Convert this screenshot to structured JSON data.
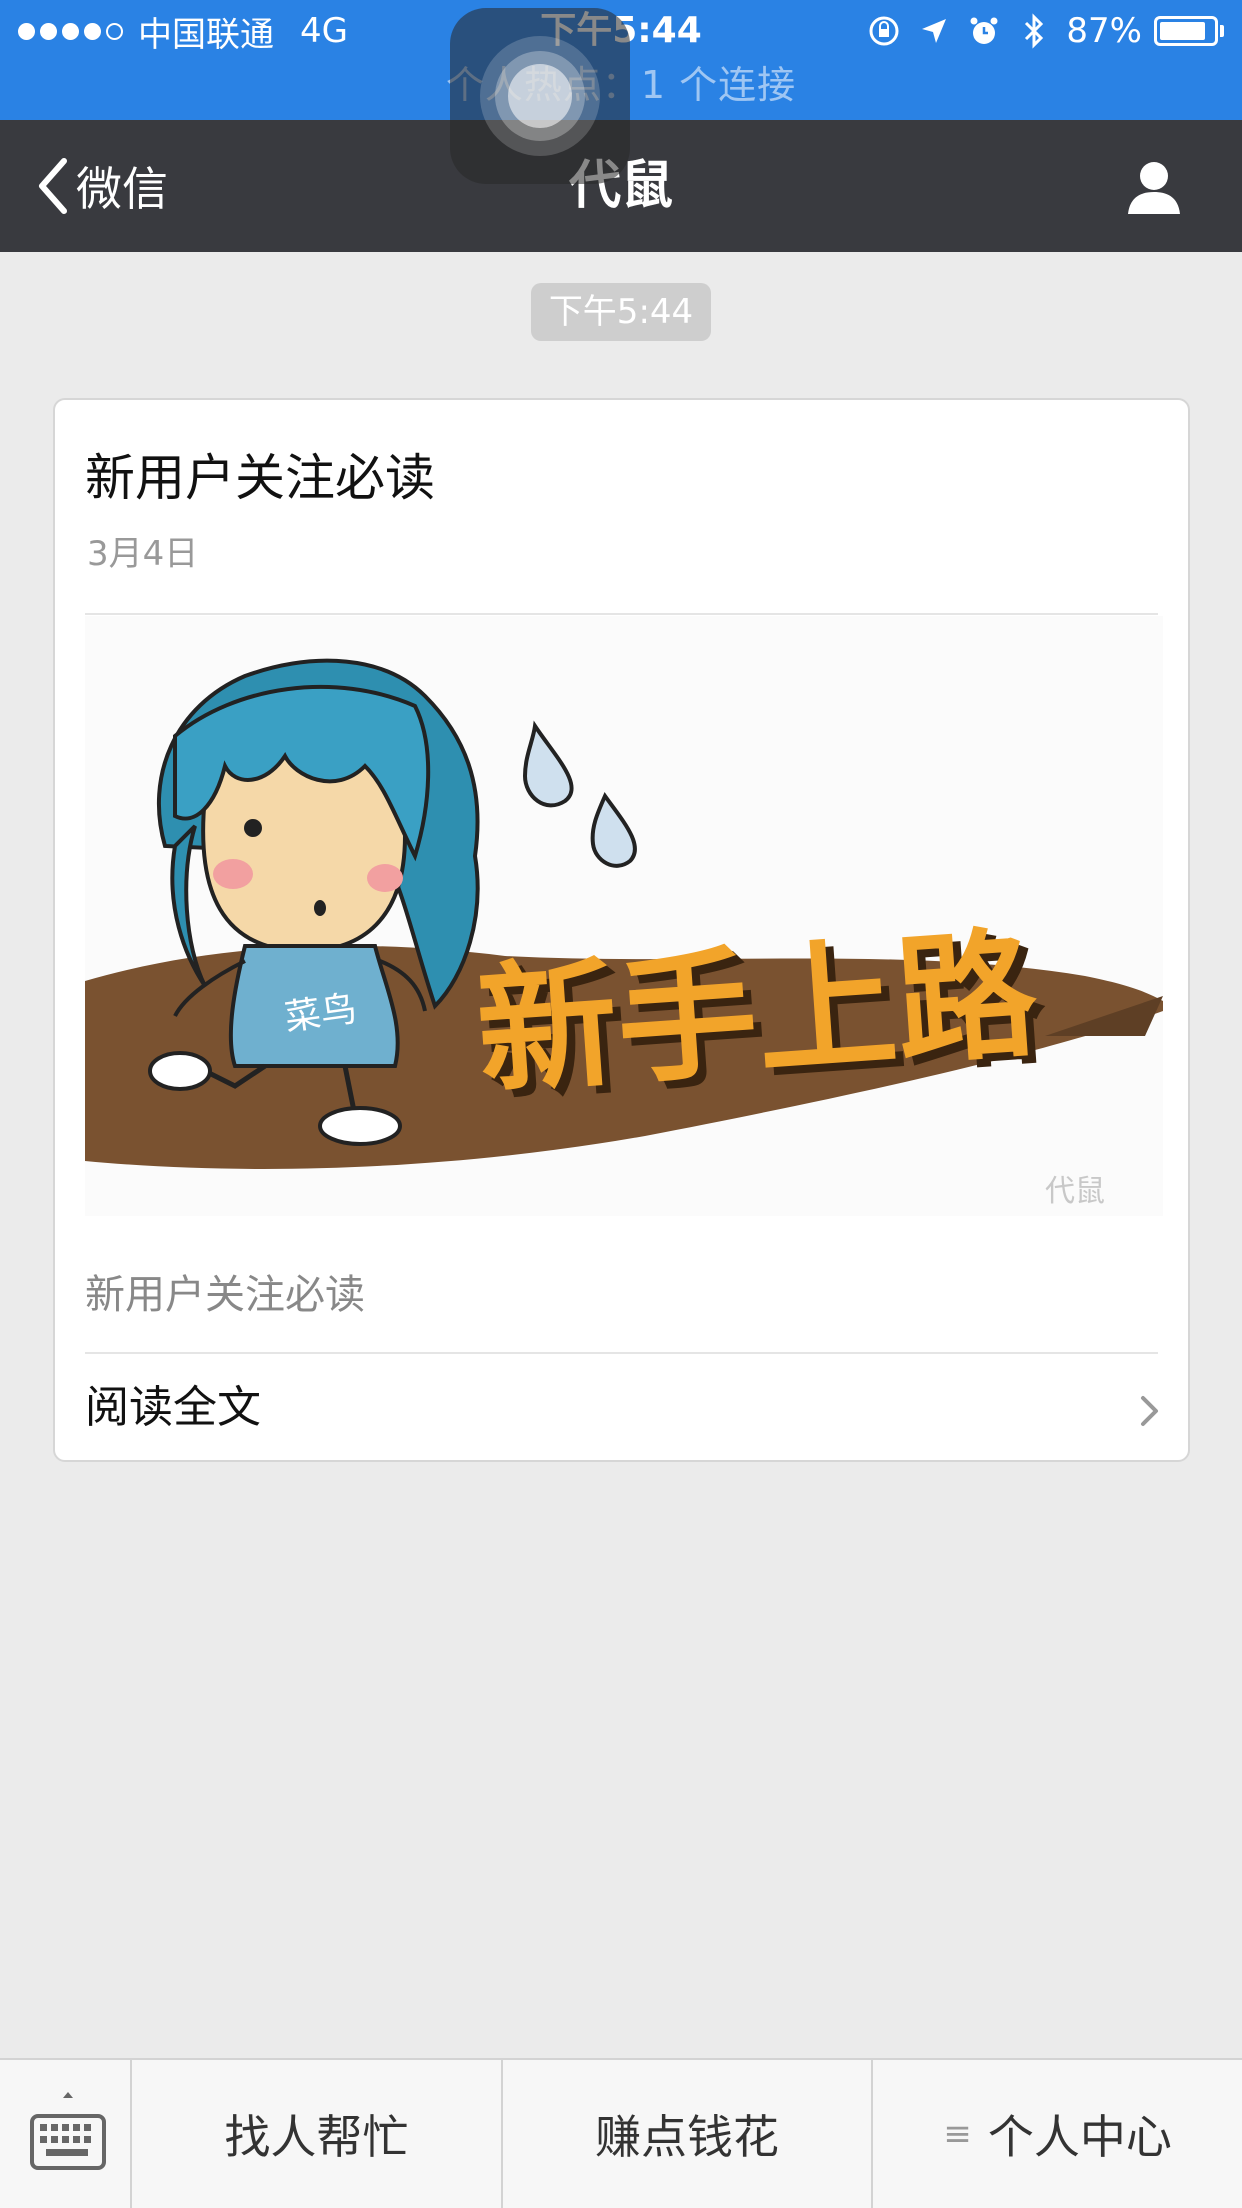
{
  "status_bar": {
    "signal_dots_on": 4,
    "signal_dots_total": 5,
    "carrier": "中国联通",
    "network": "4G",
    "time": "下午5:44",
    "battery_text": "87%",
    "battery_level": 0.87,
    "hotspot_text": "个人热点：1 个连接"
  },
  "nav": {
    "back_label": "微信",
    "title": "代鼠"
  },
  "chat": {
    "time_badge": "下午5:44",
    "card": {
      "title": "新用户关注必读",
      "date": "3月4日",
      "image_caption": "新手上路",
      "image_tag": "菜鸟",
      "image_watermark": "代鼠",
      "digest": "新用户关注必读",
      "read_more": "阅读全文"
    }
  },
  "bottom_menu": {
    "items": [
      {
        "label": "找人帮忙"
      },
      {
        "label": "赚点钱花"
      },
      {
        "label": "个人中心",
        "icon": "≡"
      }
    ]
  },
  "colors": {
    "status_bar": "#2a82e4",
    "nav_bar": "#393a3f",
    "background": "#ebebeb",
    "card": "#ffffff"
  }
}
